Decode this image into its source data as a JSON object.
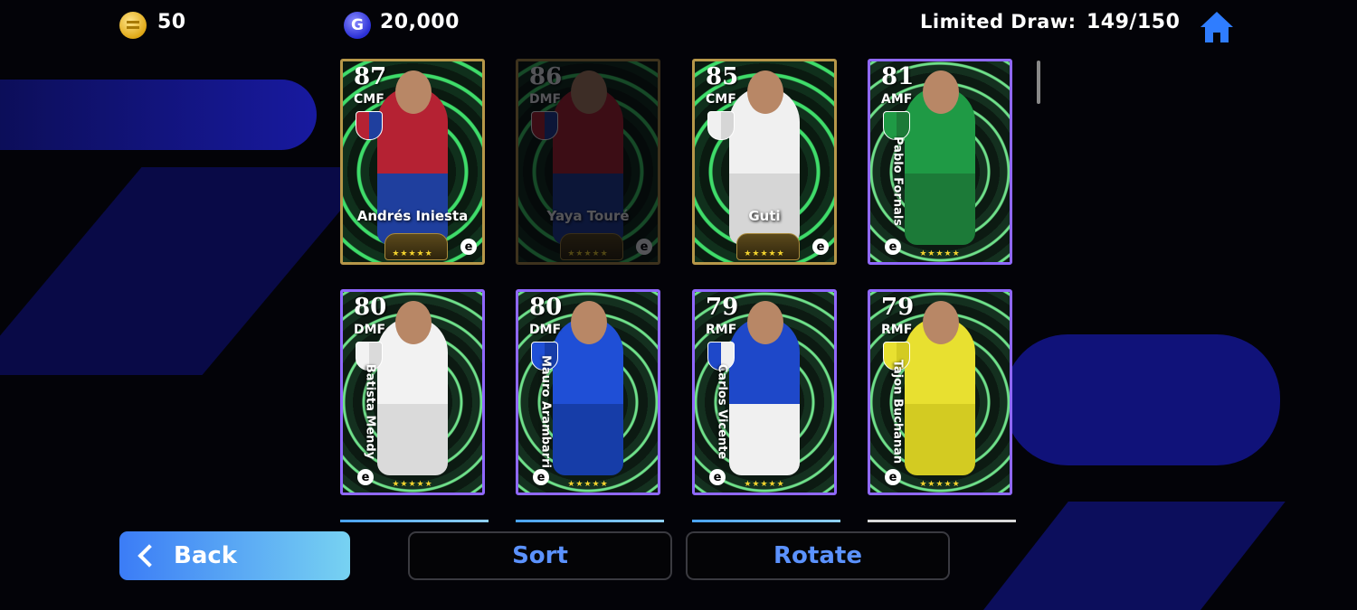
{
  "header": {
    "coins": "50",
    "gp": "20,000",
    "limited_draw_label": "Limited Draw:",
    "limited_draw_value": "149/150",
    "icons": {
      "coin": "ecoin-icon",
      "gp": "gp-icon",
      "home": "home-icon"
    }
  },
  "cards": [
    {
      "rating": "87",
      "position": "CMF",
      "name": "Andrés Iniesta",
      "style": "gold",
      "kit": "#b52233",
      "kit2": "#1f3f9e",
      "stars": "★★★★★"
    },
    {
      "rating": "86",
      "position": "DMF",
      "name": "Yaya Touré",
      "style": "gold-dim",
      "kit": "#b52233",
      "kit2": "#1f3f9e",
      "stars": "★★★★★"
    },
    {
      "rating": "85",
      "position": "CMF",
      "name": "Guti",
      "style": "gold",
      "kit": "#f0f0f0",
      "kit2": "#d6d6d6",
      "stars": "★★★★★"
    },
    {
      "rating": "81",
      "position": "AMF",
      "name": "Pablo Fornals",
      "style": "purple",
      "kit": "#1f9a45",
      "kit2": "#1c7a38",
      "stars": "★★★★★"
    },
    {
      "rating": "80",
      "position": "DMF",
      "name": "Batista Mendy",
      "style": "purple",
      "kit": "#f2f2f2",
      "kit2": "#dadada",
      "stars": "★★★★★"
    },
    {
      "rating": "80",
      "position": "DMF",
      "name": "Mauro Arambarri",
      "style": "purple",
      "kit": "#1f4fd6",
      "kit2": "#163da8",
      "stars": "★★★★★"
    },
    {
      "rating": "79",
      "position": "RMF",
      "name": "Carlos Vicente",
      "style": "purple",
      "kit": "#1e48c9",
      "kit2": "#f0f0f0",
      "stars": "★★★★★"
    },
    {
      "rating": "79",
      "position": "RMF",
      "name": "Tajon Buchanan",
      "style": "purple",
      "kit": "#e8e030",
      "kit2": "#d3cb22",
      "stars": "★★★★★"
    }
  ],
  "buttons": {
    "back": "Back",
    "sort": "Sort",
    "rotate": "Rotate"
  },
  "colors": {
    "accent": "#5b92ff",
    "back_gradient_start": "#3b7cf6",
    "back_gradient_end": "#77d2f2",
    "gold_border": "#b69749",
    "purple_border": "#9068ff"
  }
}
